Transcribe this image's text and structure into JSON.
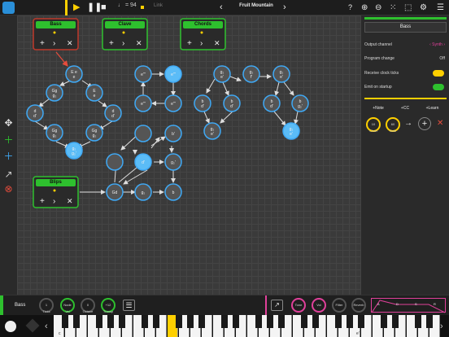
{
  "toolbar": {
    "tempo": "♩ = 94",
    "link": "Link",
    "song_title": "Fruit Mountain",
    "help": "?"
  },
  "clusters": {
    "bass": {
      "label": "Bass",
      "color": "#c0392b"
    },
    "clave": {
      "label": "Clave",
      "color": "#2ec02e"
    },
    "chords": {
      "label": "Chords",
      "color": "#2ec02e"
    },
    "blips": {
      "label": "Blips",
      "color": "#2ec02e"
    }
  },
  "nodes": {
    "n1": "E\ne",
    "n2": "Gg\ng₂",
    "n3": "E\ne",
    "n4": "d\nd'",
    "n5": "d\nd'",
    "n6": "Gg\ng₂",
    "n7": "Gg\ng₂",
    "n8": "g₂\ng₂'",
    "n9": "e'''",
    "n10": "e'''",
    "n11": "e'''",
    "n12": "e'''",
    "n13": "g₂\ne'",
    "n14": "g₂\nf'",
    "n15": "g₂\ne'",
    "n16": "b\nd'",
    "n17": "b\nd'",
    "n18": "b\nd'",
    "n19": "b\ng₂'",
    "n20": "g₂\ne'",
    "n21": "g₂\ne'",
    "n22": "b'",
    "n23": "d'",
    "n24": "g₂'",
    "n25": "Gd",
    "n26": "g₂",
    "n27": "b"
  },
  "right_panel": {
    "title": "Bass",
    "output_channel": {
      "label": "Output channel",
      "value": "Synth"
    },
    "program_change": {
      "label": "Program change",
      "value": "Off"
    },
    "receive_clock": {
      "label": "Receive clock ticks"
    },
    "emit_startup": {
      "label": "Emit on startup"
    },
    "buttons": {
      "note": "+Note",
      "cc": "+CC",
      "learn": "+Learn"
    },
    "chan": {
      "value": "10",
      "label": "Chan"
    },
    "note": {
      "value": "60",
      "label": "Note"
    }
  },
  "bottom": {
    "track_label": "Bass",
    "ticks": {
      "value": "1",
      "label": "Ticks"
    },
    "vel": {
      "value": "Node",
      "label": "Vel"
    },
    "octave": {
      "value": "0",
      "label": "Octave"
    },
    "transp": {
      "value": "+12",
      "label": "Transp"
    },
    "tone": "Tone",
    "vol": "Vol",
    "filter": "Filter",
    "reverb": "Reverb",
    "adsr": [
      "A",
      "D",
      "S",
      "R"
    ]
  },
  "piano": {
    "label_c": "c",
    "label_e": "e'"
  }
}
